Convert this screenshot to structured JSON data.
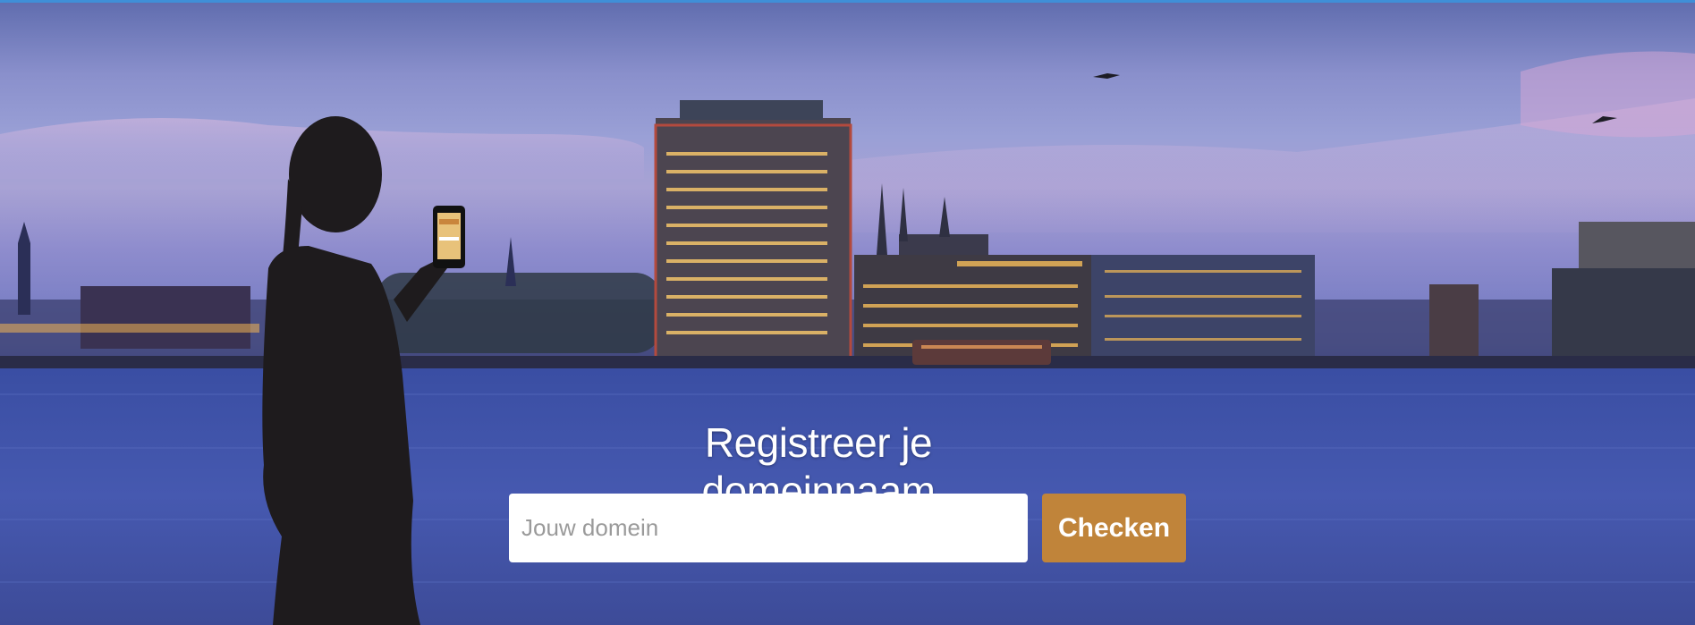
{
  "hero": {
    "headline": "Registreer je domeinnaam",
    "search": {
      "placeholder": "Jouw domein",
      "value": "",
      "button_label": "Checken"
    }
  },
  "colors": {
    "accent_button": "#c0843a",
    "top_line": "#3f8fd8",
    "water": "#3b51a6",
    "sky": "#9aa0d6"
  },
  "icons": {
    "phone": "smartphone-icon",
    "birds": "bird-icon"
  }
}
